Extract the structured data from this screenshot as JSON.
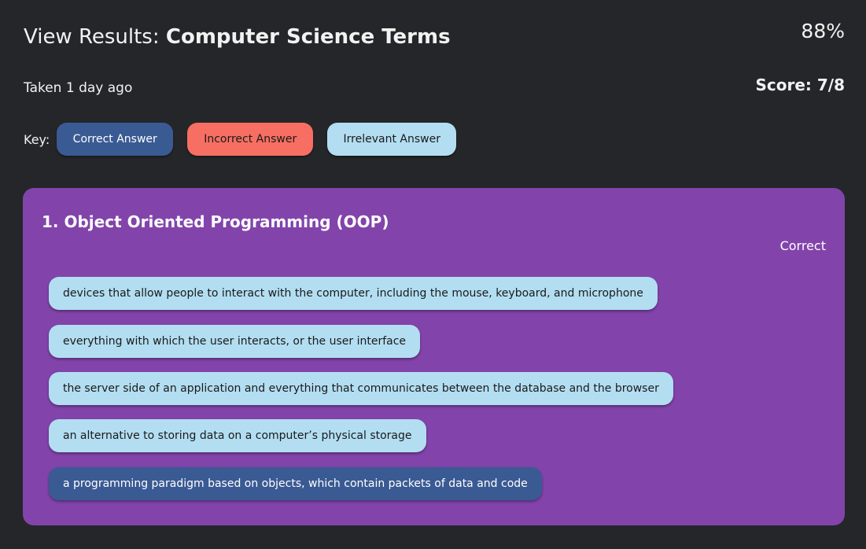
{
  "header": {
    "title_prefix": "View Results:",
    "quiz_name": "Computer Science Terms",
    "percent": "88%",
    "taken": "Taken 1 day ago",
    "score": "Score: 7/8"
  },
  "key": {
    "label": "Key:",
    "correct": "Correct Answer",
    "incorrect": "Incorrect Answer",
    "irrelevant": "Irrelevant Answer"
  },
  "question": {
    "title": "1. Object Oriented Programming (OOP)",
    "status": "Correct",
    "answers": [
      {
        "text": "devices that allow people to interact with the computer, including the mouse, keyboard, and microphone",
        "type": "irrelevant"
      },
      {
        "text": "everything with which the user interacts, or the user interface",
        "type": "irrelevant"
      },
      {
        "text": "the server side of an application and everything that communicates between the database and the browser",
        "type": "irrelevant"
      },
      {
        "text": "an alternative to storing data on a computer’s physical storage",
        "type": "irrelevant"
      },
      {
        "text": "a programming paradigm based on objects, which contain packets of data and code",
        "type": "correct"
      }
    ]
  },
  "colors": {
    "background": "#252629",
    "card": "#8244ab",
    "correct": "#3a5a93",
    "incorrect": "#f76f62",
    "irrelevant": "#b3def2"
  }
}
